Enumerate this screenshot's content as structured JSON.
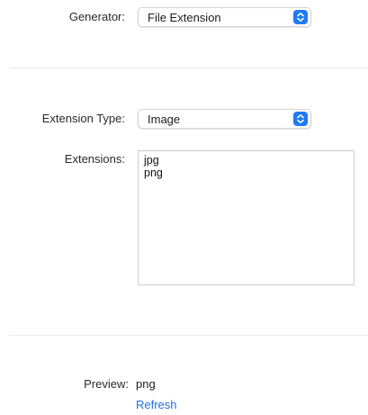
{
  "generator": {
    "label": "Generator:",
    "value": "File Extension"
  },
  "extension_type": {
    "label": "Extension Type:",
    "value": "Image"
  },
  "extensions": {
    "label": "Extensions:",
    "lines": [
      "jpg",
      "png"
    ]
  },
  "preview": {
    "label": "Preview:",
    "value": "png",
    "refresh_label": "Refresh"
  },
  "colors": {
    "accent": "#1f7af5",
    "link": "#1f6fdc"
  },
  "icons": {
    "popup_stepper": "up-down-chevron-icon"
  }
}
